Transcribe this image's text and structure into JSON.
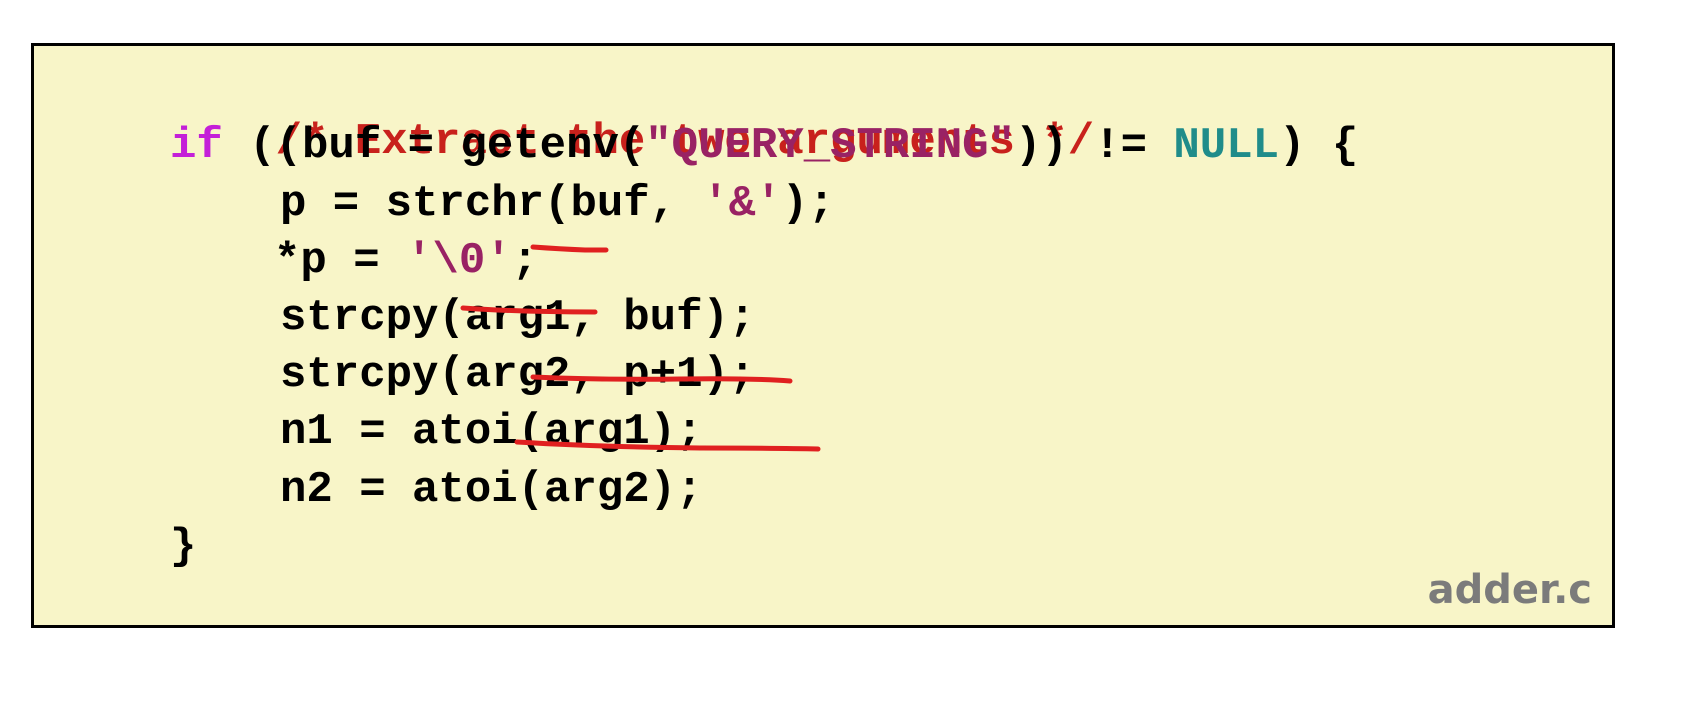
{
  "code": {
    "comment": "/* Extract the two arguments */",
    "line_if": {
      "keyword": "if",
      "part1": " ((buf = getenv(",
      "string": "\"QUERY_STRING\"",
      "part2": ")) != ",
      "constant": "NULL",
      "part3": ") {"
    },
    "line_strchr": {
      "part1": "p = strchr(buf, ",
      "char": "'&'",
      "part2": ");"
    },
    "line_nul": {
      "part1": "*p = ",
      "char": "'\\0'",
      "part2": ";"
    },
    "line_strcpy1": "strcpy(arg1, buf);",
    "line_strcpy2": "strcpy(arg2, p+1);",
    "line_n1": "n1 = atoi(arg1);",
    "line_n2": "n2 = atoi(arg2);",
    "close_brace": "}"
  },
  "filename": "adder.c",
  "colors": {
    "background": "#f8f5c8",
    "keyword": "#c41fd8",
    "comment": "#c8211c",
    "string": "#992264",
    "constant": "#208c8a",
    "annotation": "#e02020",
    "filename": "#7b7b7b"
  },
  "annotations": [
    "underline-chr",
    "underline-nul-char",
    "underline-arg1-buf",
    "underline-arg2-p1"
  ]
}
